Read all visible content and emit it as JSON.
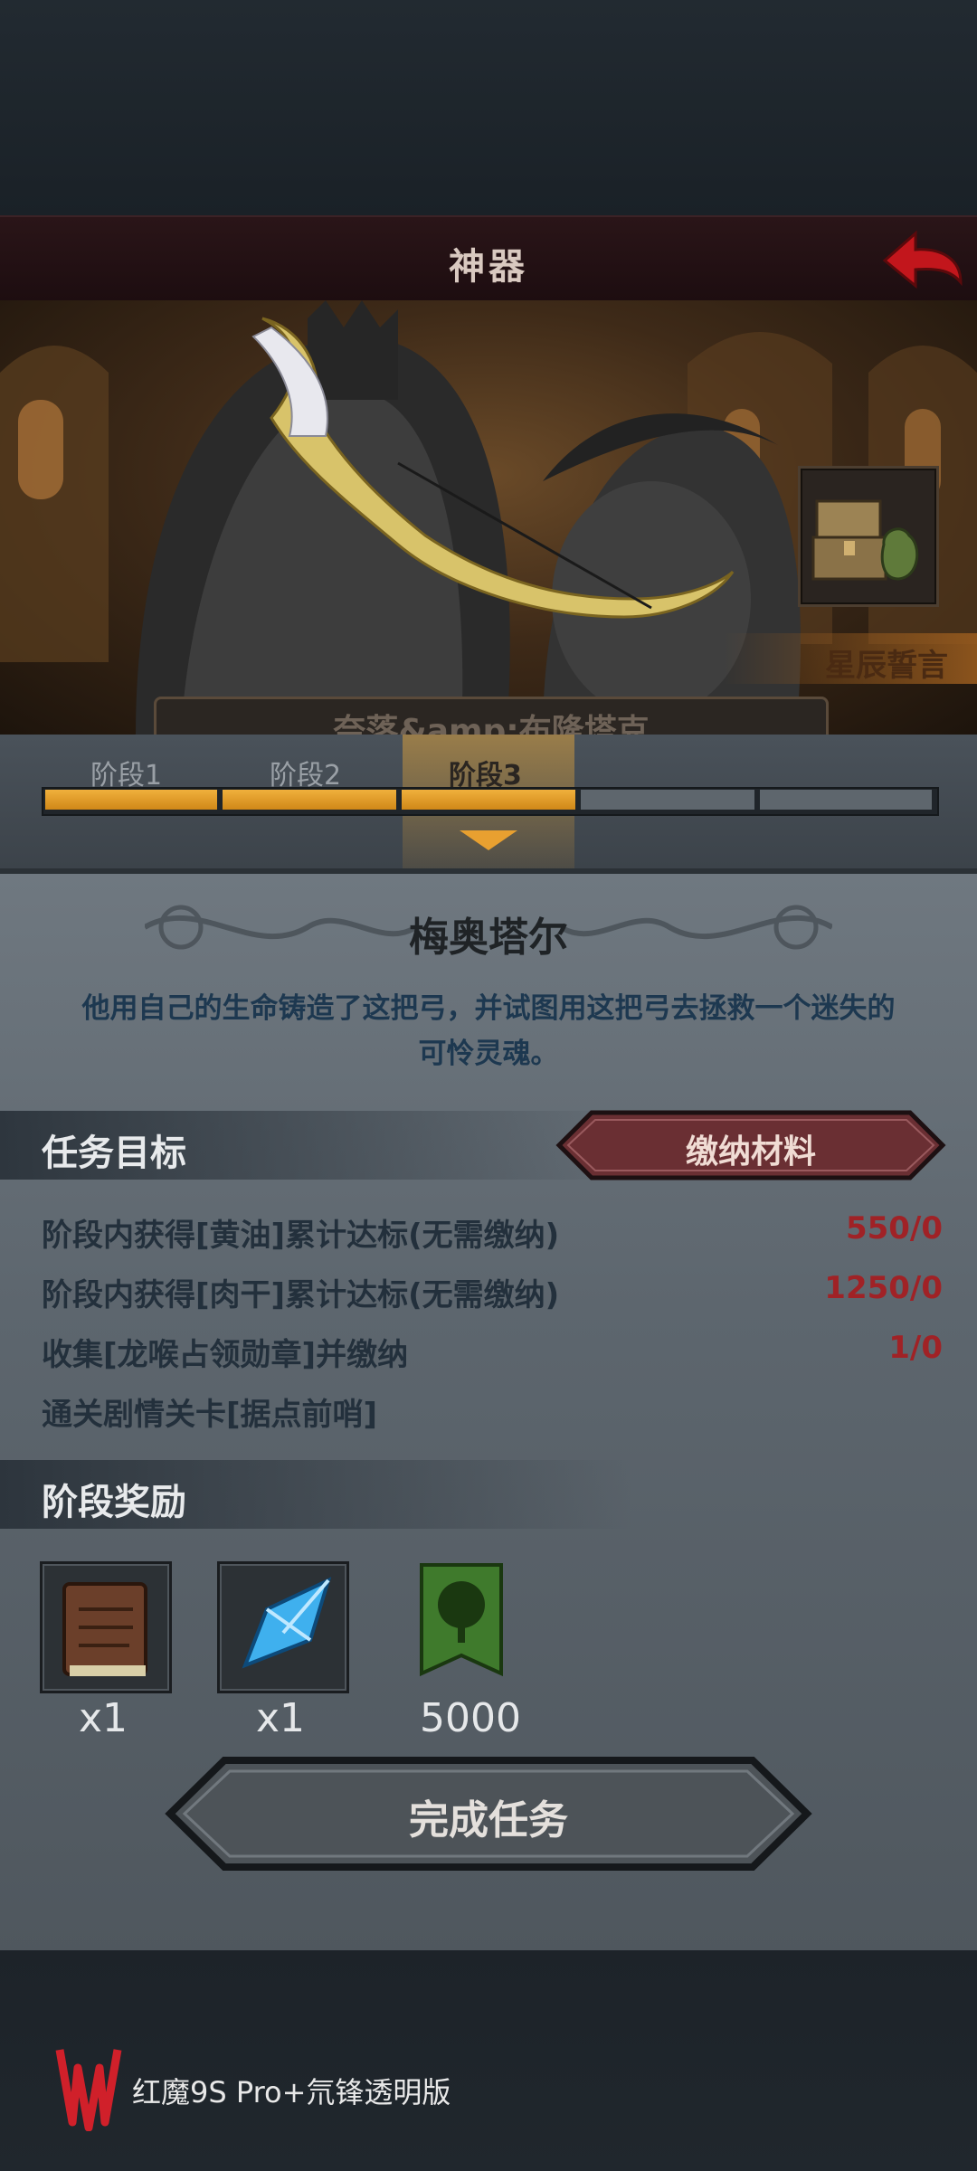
{
  "header": {
    "title": "神器"
  },
  "hero": {
    "star_oath_label": "星辰誓言",
    "name_plate": "奈落&amp;布隆塔克"
  },
  "stages": {
    "labels": [
      "阶段1",
      "阶段2",
      "阶段3"
    ],
    "active_index": 3,
    "segments_total": 5,
    "segments_filled": 3
  },
  "artifact": {
    "name": "梅奥塔尔",
    "description_line1": "他用自己的生命铸造了这把弓，并试图用这把弓去拯救一个迷失的",
    "description_line2": "可怜灵魂。"
  },
  "tasks": {
    "title": "任务目标",
    "submit_label": "缴纳材料",
    "items": [
      {
        "text": "阶段内获得[黄油]累计达标(无需缴纳)",
        "value": "550/0"
      },
      {
        "text": "阶段内获得[肉干]累计达标(无需缴纳)",
        "value": "1250/0"
      },
      {
        "text": "收集[龙喉占领勋章]并缴纳",
        "value": "1/0"
      },
      {
        "text": "通关剧情关卡[据点前哨]",
        "value": ""
      }
    ]
  },
  "rewards": {
    "title": "阶段奖励",
    "items": [
      {
        "icon": "book-icon",
        "count": "x1"
      },
      {
        "icon": "crystal-icon",
        "count": "x1"
      },
      {
        "icon": "tree-banner-icon",
        "count": "5000"
      }
    ]
  },
  "complete_button": {
    "label": "完成任务"
  },
  "watermark": {
    "text": "红魔9S Pro+氘锋透明版"
  },
  "colors": {
    "accent_orange": "#e8a030",
    "value_red": "#a02226",
    "description_blue": "#1d3850"
  }
}
